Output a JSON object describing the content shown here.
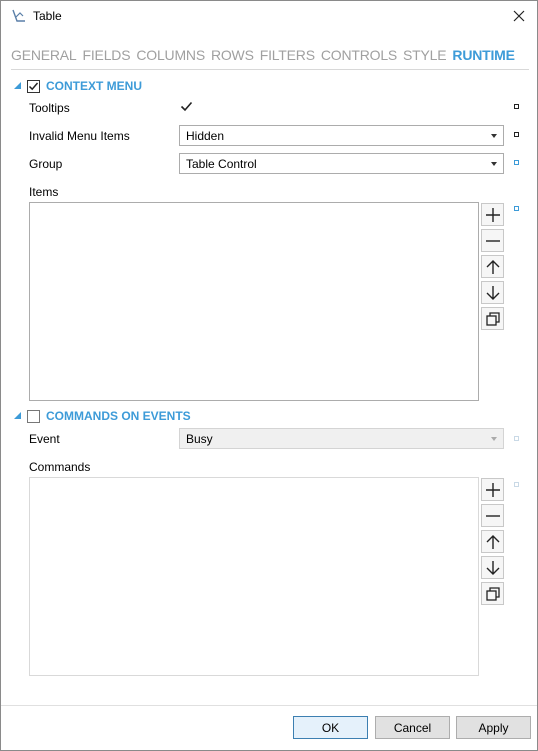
{
  "window": {
    "title": "Table"
  },
  "tabs": [
    {
      "label": "GENERAL",
      "active": false
    },
    {
      "label": "FIELDS",
      "active": false
    },
    {
      "label": "COLUMNS",
      "active": false
    },
    {
      "label": "ROWS",
      "active": false
    },
    {
      "label": "FILTERS",
      "active": false
    },
    {
      "label": "CONTROLS",
      "active": false
    },
    {
      "label": "STYLE",
      "active": false
    },
    {
      "label": "RUNTIME",
      "active": true
    }
  ],
  "context_menu": {
    "label": "CONTEXT MENU",
    "enabled": true,
    "tooltips_label": "Tooltips",
    "tooltips_checked": true,
    "invalid_items_label": "Invalid Menu Items",
    "invalid_items_value": "Hidden",
    "group_label": "Group",
    "group_value": "Table Control",
    "items_label": "Items",
    "items": []
  },
  "commands_on_events": {
    "label": "COMMANDS ON EVENTS",
    "enabled": false,
    "event_label": "Event",
    "event_value": "Busy",
    "commands_label": "Commands",
    "commands": []
  },
  "list_buttons": [
    "add-icon",
    "remove-icon",
    "move-up-icon",
    "move-down-icon",
    "duplicate-icon"
  ],
  "footer": {
    "ok": "OK",
    "cancel": "Cancel",
    "apply": "Apply"
  },
  "colors": {
    "accent": "#3d9bd8",
    "inactive_tab": "#a0a0a0"
  }
}
